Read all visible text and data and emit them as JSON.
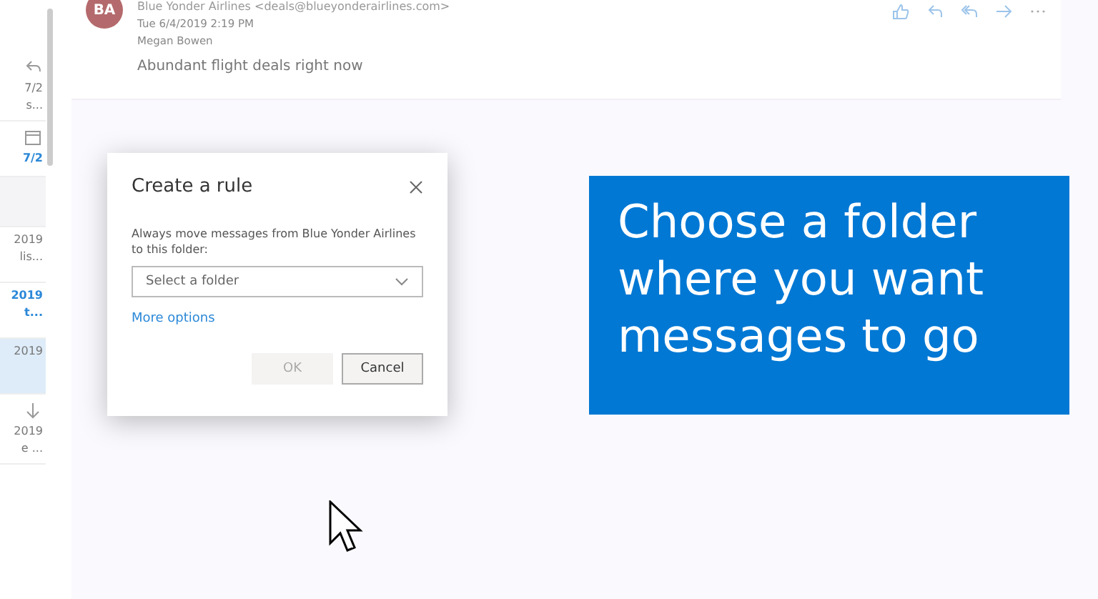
{
  "message_list": [
    {
      "kind": "reply",
      "date": "7/2",
      "preview": "s...",
      "unread": false,
      "selected": false
    },
    {
      "kind": "calendar",
      "date": "7/2",
      "unread": true,
      "selected": false
    },
    {
      "kind": "blank",
      "selected": false
    },
    {
      "kind": "plain",
      "date": "2019",
      "preview": "lis...",
      "unread": false,
      "selected": false
    },
    {
      "kind": "plain",
      "date": "2019",
      "preview": "t...",
      "unread": true,
      "selected": false
    },
    {
      "kind": "plain",
      "date": "2019",
      "unread": false,
      "selected": true
    },
    {
      "kind": "down",
      "date": "2019",
      "preview": "e ...",
      "unread": false,
      "selected": false
    }
  ],
  "email": {
    "avatar": "BA",
    "sender": "Blue Yonder Airlines <deals@blueyonderairlines.com>",
    "date": "Tue 6/4/2019 2:19 PM",
    "recipient": "Megan Bowen",
    "body": "Abundant flight deals right now"
  },
  "dialog": {
    "title": "Create a rule",
    "message": "Always move messages from Blue Yonder Airlines to this folder:",
    "folder_placeholder": "Select a folder",
    "more_options": "More options",
    "buttons": [
      {
        "label": "OK",
        "disabled": true
      },
      {
        "label": "Cancel",
        "disabled": false
      }
    ]
  },
  "callout": "Choose a folder where you want messages to go"
}
